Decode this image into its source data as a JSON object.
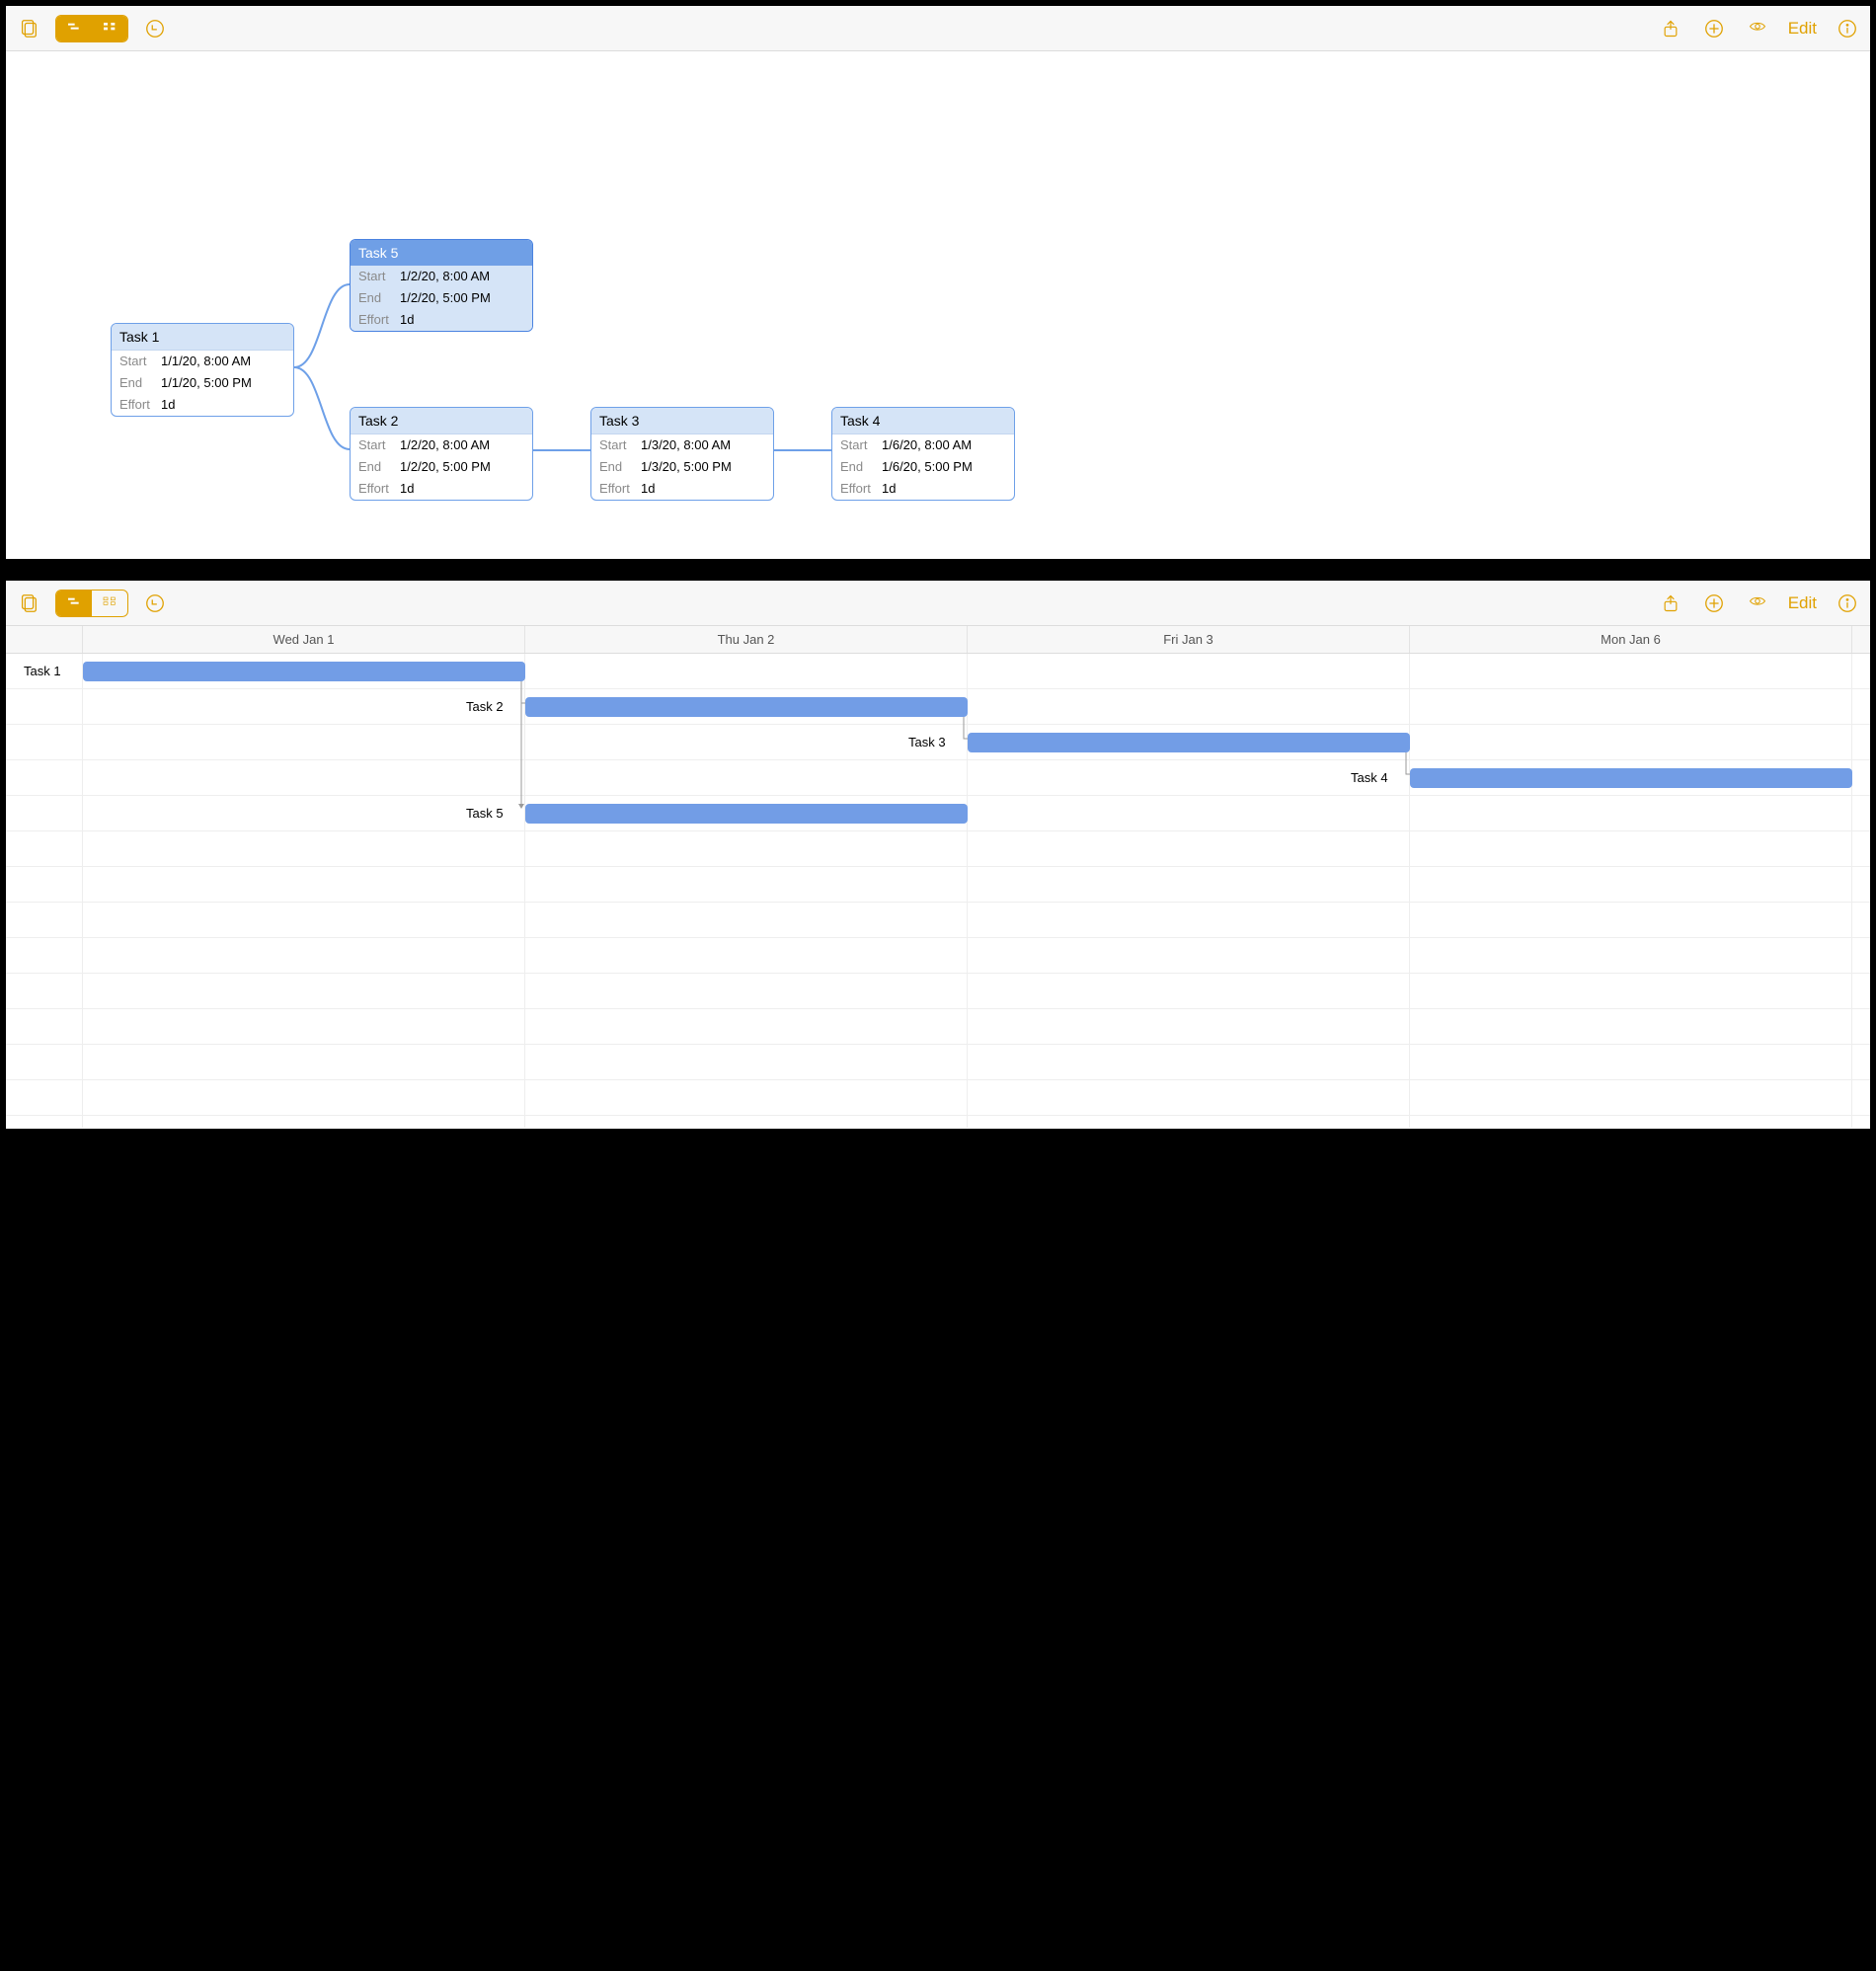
{
  "toolbar": {
    "edit_label": "Edit"
  },
  "labels": {
    "start": "Start",
    "end": "End",
    "effort": "Effort"
  },
  "tasks": [
    {
      "id": 1,
      "name": "Task 1",
      "start": "1/1/20, 8:00 AM",
      "end": "1/1/20, 5:00 PM",
      "effort": "1d"
    },
    {
      "id": 2,
      "name": "Task 2",
      "start": "1/2/20, 8:00 AM",
      "end": "1/2/20, 5:00 PM",
      "effort": "1d"
    },
    {
      "id": 3,
      "name": "Task 3",
      "start": "1/3/20, 8:00 AM",
      "end": "1/3/20, 5:00 PM",
      "effort": "1d"
    },
    {
      "id": 4,
      "name": "Task 4",
      "start": "1/6/20, 8:00 AM",
      "end": "1/6/20, 5:00 PM",
      "effort": "1d"
    },
    {
      "id": 5,
      "name": "Task 5",
      "start": "1/2/20, 8:00 AM",
      "end": "1/2/20, 5:00 PM",
      "effort": "1d"
    }
  ],
  "gantt": {
    "columns": [
      "Wed Jan 1",
      "Thu Jan 2",
      "Fri Jan 3",
      "Mon Jan 6"
    ],
    "rows": [
      {
        "label": "Task 1",
        "col": 0
      },
      {
        "label": "Task 2",
        "col": 1
      },
      {
        "label": "Task 3",
        "col": 2
      },
      {
        "label": "Task 4",
        "col": 3
      },
      {
        "label": "Task 5",
        "col": 1
      }
    ]
  },
  "chart_data": {
    "type": "gantt",
    "categories": [
      "Wed Jan 1",
      "Thu Jan 2",
      "Fri Jan 3",
      "Mon Jan 6"
    ],
    "series": [
      {
        "name": "Task 1",
        "start_col": 0,
        "duration_cols": 1
      },
      {
        "name": "Task 2",
        "start_col": 1,
        "duration_cols": 1
      },
      {
        "name": "Task 3",
        "start_col": 2,
        "duration_cols": 1
      },
      {
        "name": "Task 4",
        "start_col": 3,
        "duration_cols": 1
      },
      {
        "name": "Task 5",
        "start_col": 1,
        "duration_cols": 1
      }
    ],
    "dependencies": [
      [
        "Task 1",
        "Task 2"
      ],
      [
        "Task 2",
        "Task 3"
      ],
      [
        "Task 3",
        "Task 4"
      ],
      [
        "Task 1",
        "Task 5"
      ]
    ]
  }
}
